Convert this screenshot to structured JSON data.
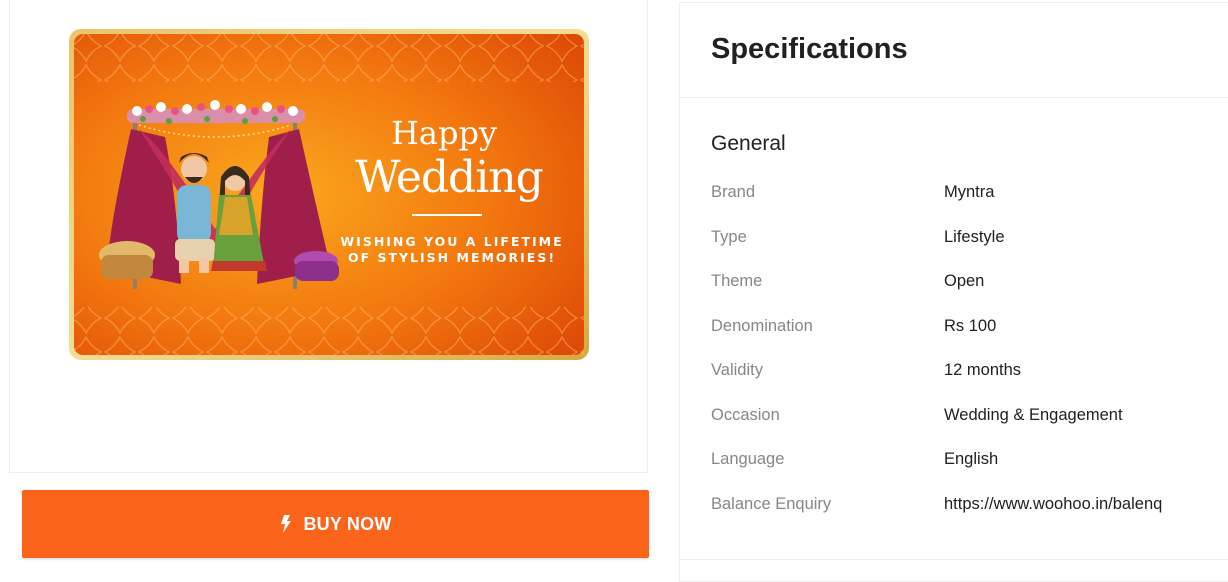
{
  "product_image": {
    "alt": "Happy Wedding gift card",
    "happy": "Happy",
    "wedding": "Wedding",
    "wish_line1": "WISHING YOU A LIFETIME",
    "wish_line2": "OF STYLISH MEMORIES!"
  },
  "buy_button": {
    "label": "BUY NOW",
    "icon": "lightning-bolt-icon",
    "color": "#fb641b"
  },
  "specifications": {
    "title": "Specifications",
    "group": "General",
    "rows": [
      {
        "key": "Brand",
        "value": "Myntra"
      },
      {
        "key": "Type",
        "value": "Lifestyle"
      },
      {
        "key": "Theme",
        "value": "Open"
      },
      {
        "key": "Denomination",
        "value": "Rs 100"
      },
      {
        "key": "Validity",
        "value": "12 months"
      },
      {
        "key": "Occasion",
        "value": "Wedding & Engagement"
      },
      {
        "key": "Language",
        "value": "English"
      },
      {
        "key": "Balance Enquiry",
        "value": "https://www.woohoo.in/balenq"
      }
    ]
  },
  "colors": {
    "accent": "#fb641b",
    "card_orange": "#f07a12",
    "text_dark": "#212121",
    "text_muted": "#878787"
  }
}
